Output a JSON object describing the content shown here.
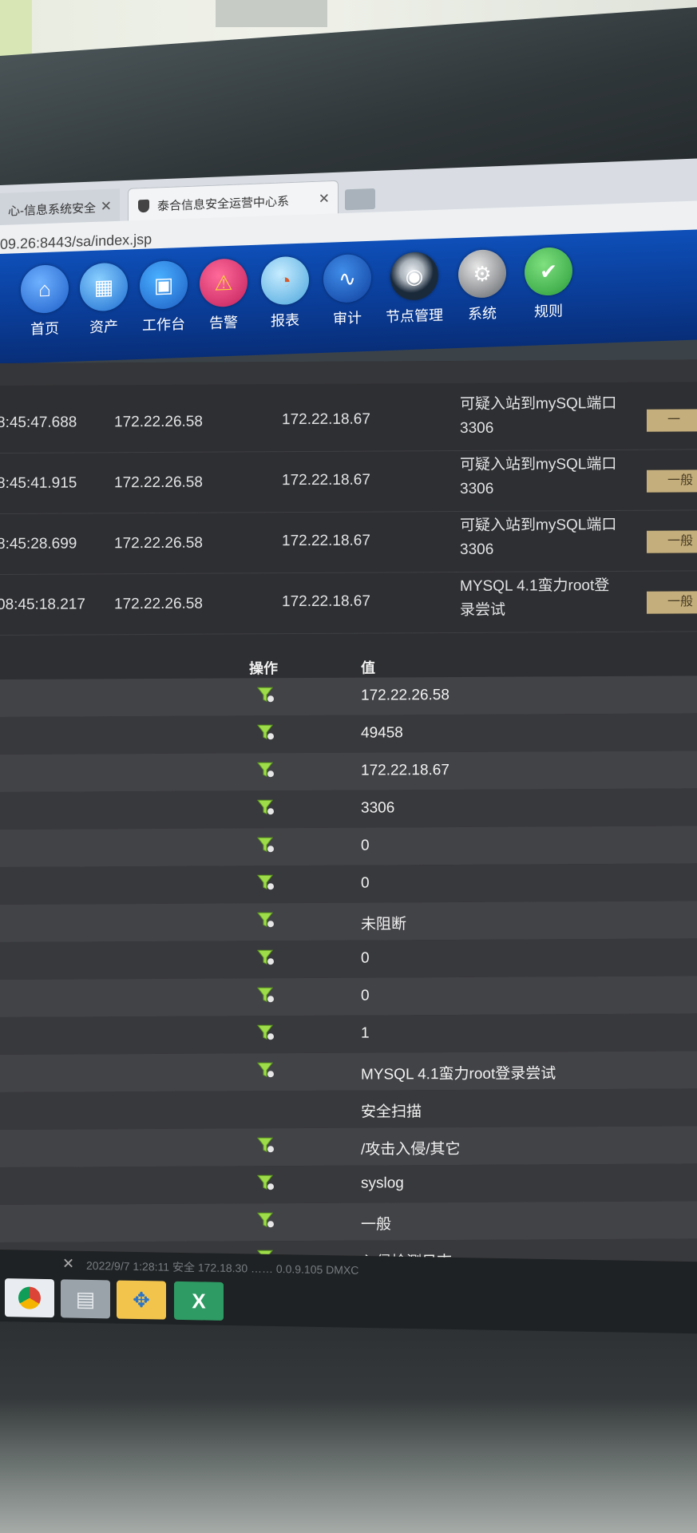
{
  "browser": {
    "tabs": [
      {
        "label": "心-信息系统安全",
        "active": false
      },
      {
        "label": "泰合信息安全运营中心系",
        "active": true
      },
      {
        "label": "",
        "active": false
      }
    ],
    "address": "09.26:8443/sa/index.jsp"
  },
  "nav": [
    {
      "label": "首页",
      "icon": "home-icon",
      "color": "#2a6fd6"
    },
    {
      "label": "资产",
      "icon": "assets-icon",
      "color": "#2a6fd6"
    },
    {
      "label": "工作台",
      "icon": "workbench-icon",
      "color": "#2b7bd8"
    },
    {
      "label": "告警",
      "icon": "warning-icon",
      "color": "#d6336c"
    },
    {
      "label": "报表",
      "icon": "report-icon",
      "color": "#4aa8e0"
    },
    {
      "label": "审计",
      "icon": "audit-icon",
      "color": "#1e5bc7"
    },
    {
      "label": "节点管理",
      "icon": "camera-icon",
      "color": "#1b2a3b"
    },
    {
      "label": "系统",
      "icon": "gear-icon",
      "color": "#6c6f73"
    },
    {
      "label": "规则",
      "icon": "check-icon",
      "color": "#3aae48"
    }
  ],
  "events": [
    {
      "time": "8:45:47.688",
      "src": "172.22.26.58",
      "dst": "172.22.18.67",
      "name_line1": "可疑入站到mySQL端口",
      "name_line2": "3306",
      "level": "一"
    },
    {
      "time": "8:45:41.915",
      "src": "172.22.26.58",
      "dst": "172.22.18.67",
      "name_line1": "可疑入站到mySQL端口",
      "name_line2": "3306",
      "level": "一般"
    },
    {
      "time": "8:45:28.699",
      "src": "172.22.26.58",
      "dst": "172.22.18.67",
      "name_line1": "可疑入站到mySQL端口",
      "name_line2": "3306",
      "level": "一般"
    },
    {
      "time": "08:45:18.217",
      "src": "172.22.26.58",
      "dst": "172.22.18.67",
      "name_line1": "MYSQL 4.1蛮力root登",
      "name_line2": "录尝试",
      "level": "一般"
    }
  ],
  "detail": {
    "col_op": "操作",
    "col_val": "值",
    "rows": [
      {
        "value": "172.22.26.58",
        "filter": true
      },
      {
        "value": "49458",
        "filter": true
      },
      {
        "value": "172.22.18.67",
        "filter": true
      },
      {
        "value": "3306",
        "filter": true
      },
      {
        "value": "0",
        "filter": true
      },
      {
        "value": "0",
        "filter": true
      },
      {
        "value": "未阻断",
        "filter": true
      },
      {
        "value": "0",
        "filter": true
      },
      {
        "value": "0",
        "filter": true
      },
      {
        "value": "1",
        "filter": true
      },
      {
        "value": "MYSQL 4.1蛮力root登录尝试",
        "filter": true
      },
      {
        "value": "安全扫描",
        "filter": false
      },
      {
        "value": "/攻击入侵/其它",
        "filter": true
      },
      {
        "value": "syslog",
        "filter": true
      },
      {
        "value": "一般",
        "filter": true
      },
      {
        "value": "入侵检测日志",
        "filter": true
      }
    ]
  },
  "taskbar": {
    "status": "2022/9/7 1:28:11  安全  172.18.30  …… 0.0.9.105  DMXC",
    "apps": [
      {
        "icon": "chrome-icon",
        "color": "#e9edf1"
      },
      {
        "icon": "folder-icon",
        "color": "#9aa3aa"
      },
      {
        "icon": "puzzle-icon",
        "color": "#f3c44b"
      },
      {
        "icon": "excel-icon",
        "color": "#2d9b63"
      }
    ]
  }
}
